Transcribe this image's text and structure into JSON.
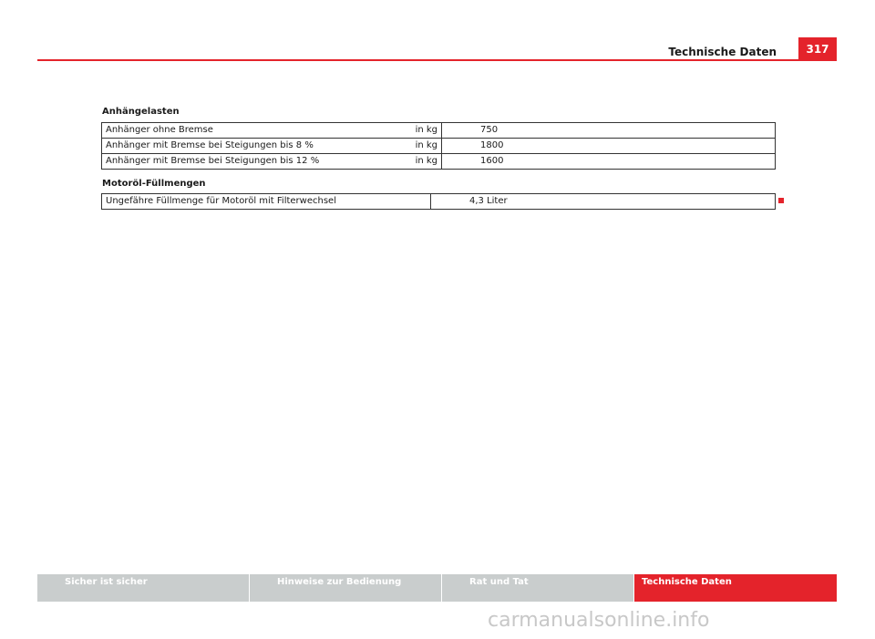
{
  "header": {
    "title": "Technische Daten",
    "page_number": "317"
  },
  "sections": [
    {
      "heading": "Anhängelasten",
      "rows": [
        {
          "label": "Anhänger ohne Bremse",
          "unit": "in kg",
          "value": "750"
        },
        {
          "label": "Anhänger mit Bremse bei Steigungen bis 8 %",
          "unit": "in kg",
          "value": "1800"
        },
        {
          "label": "Anhänger mit Bremse bei Steigungen bis 12 %",
          "unit": "in kg",
          "value": "1600"
        }
      ]
    },
    {
      "heading": "Motoröl-Füllmengen",
      "rows": [
        {
          "label": "Ungefähre Füllmenge für Motoröl mit Filterwechsel",
          "value": "4,3 Liter"
        }
      ]
    }
  ],
  "footer": {
    "tabs": [
      {
        "label": "Sicher ist sicher"
      },
      {
        "label": "Hinweise zur Bedienung"
      },
      {
        "label": "Rat und Tat"
      },
      {
        "label": "Technische Daten"
      }
    ]
  },
  "watermark": "carmanualsonline.info",
  "colors": {
    "accent": "#e4232b",
    "footer_inactive": "#c9cdcd"
  }
}
